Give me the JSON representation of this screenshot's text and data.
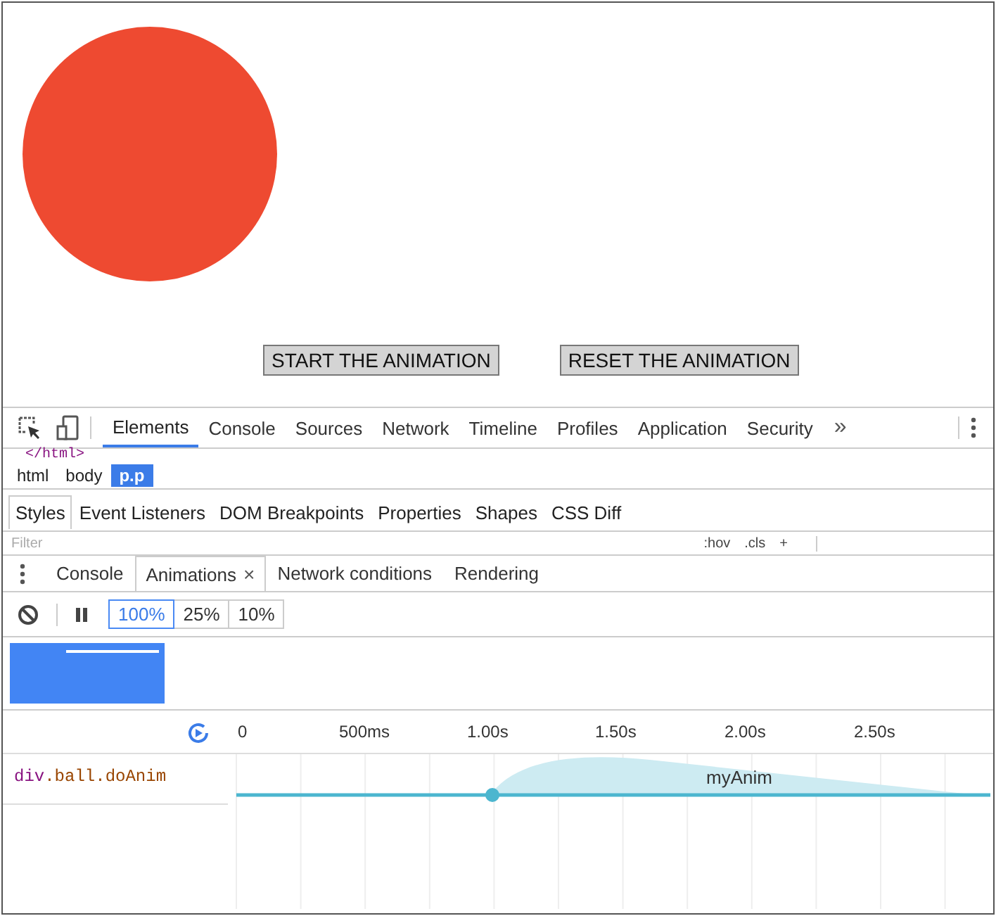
{
  "page": {
    "buttons": [
      "START THE ANIMATION",
      "RESET THE ANIMATION"
    ]
  },
  "devtools": {
    "tabs": [
      {
        "label": "Elements",
        "selected": true
      },
      {
        "label": "Console",
        "selected": false
      },
      {
        "label": "Sources",
        "selected": false
      },
      {
        "label": "Network",
        "selected": false
      },
      {
        "label": "Timeline",
        "selected": false
      },
      {
        "label": "Profiles",
        "selected": false
      },
      {
        "label": "Application",
        "selected": false
      },
      {
        "label": "Security",
        "selected": false
      }
    ],
    "overflow": "»",
    "dom_line": "</html>",
    "breadcrumbs": [
      {
        "label": "html",
        "selected": false
      },
      {
        "label": "body",
        "selected": false
      },
      {
        "label": "p.p",
        "selected": true
      }
    ],
    "sidebar_tabs": [
      {
        "label": "Styles",
        "selected": true
      },
      {
        "label": "Event Listeners",
        "selected": false
      },
      {
        "label": "DOM Breakpoints",
        "selected": false
      },
      {
        "label": "Properties",
        "selected": false
      },
      {
        "label": "Shapes",
        "selected": false
      },
      {
        "label": "CSS Diff",
        "selected": false
      }
    ],
    "filter": {
      "placeholder": "Filter"
    },
    "style_tools": [
      ":hov",
      ".cls",
      "+"
    ]
  },
  "drawer": {
    "tabs": [
      {
        "label": "Console",
        "selected": false,
        "closable": false
      },
      {
        "label": "Animations",
        "selected": true,
        "closable": true
      },
      {
        "label": "Network conditions",
        "selected": false,
        "closable": false
      },
      {
        "label": "Rendering",
        "selected": false,
        "closable": false
      }
    ],
    "close": "×",
    "speeds": [
      {
        "label": "100%",
        "selected": true
      },
      {
        "label": "25%",
        "selected": false
      },
      {
        "label": "10%",
        "selected": false
      }
    ],
    "ticks": [
      "0",
      "500ms",
      "1.00s",
      "1.50s",
      "2.00s",
      "2.50s"
    ],
    "animations": [
      {
        "selector": "div",
        "classes": ".ball.doAnim",
        "name": "myAnim"
      }
    ]
  }
}
